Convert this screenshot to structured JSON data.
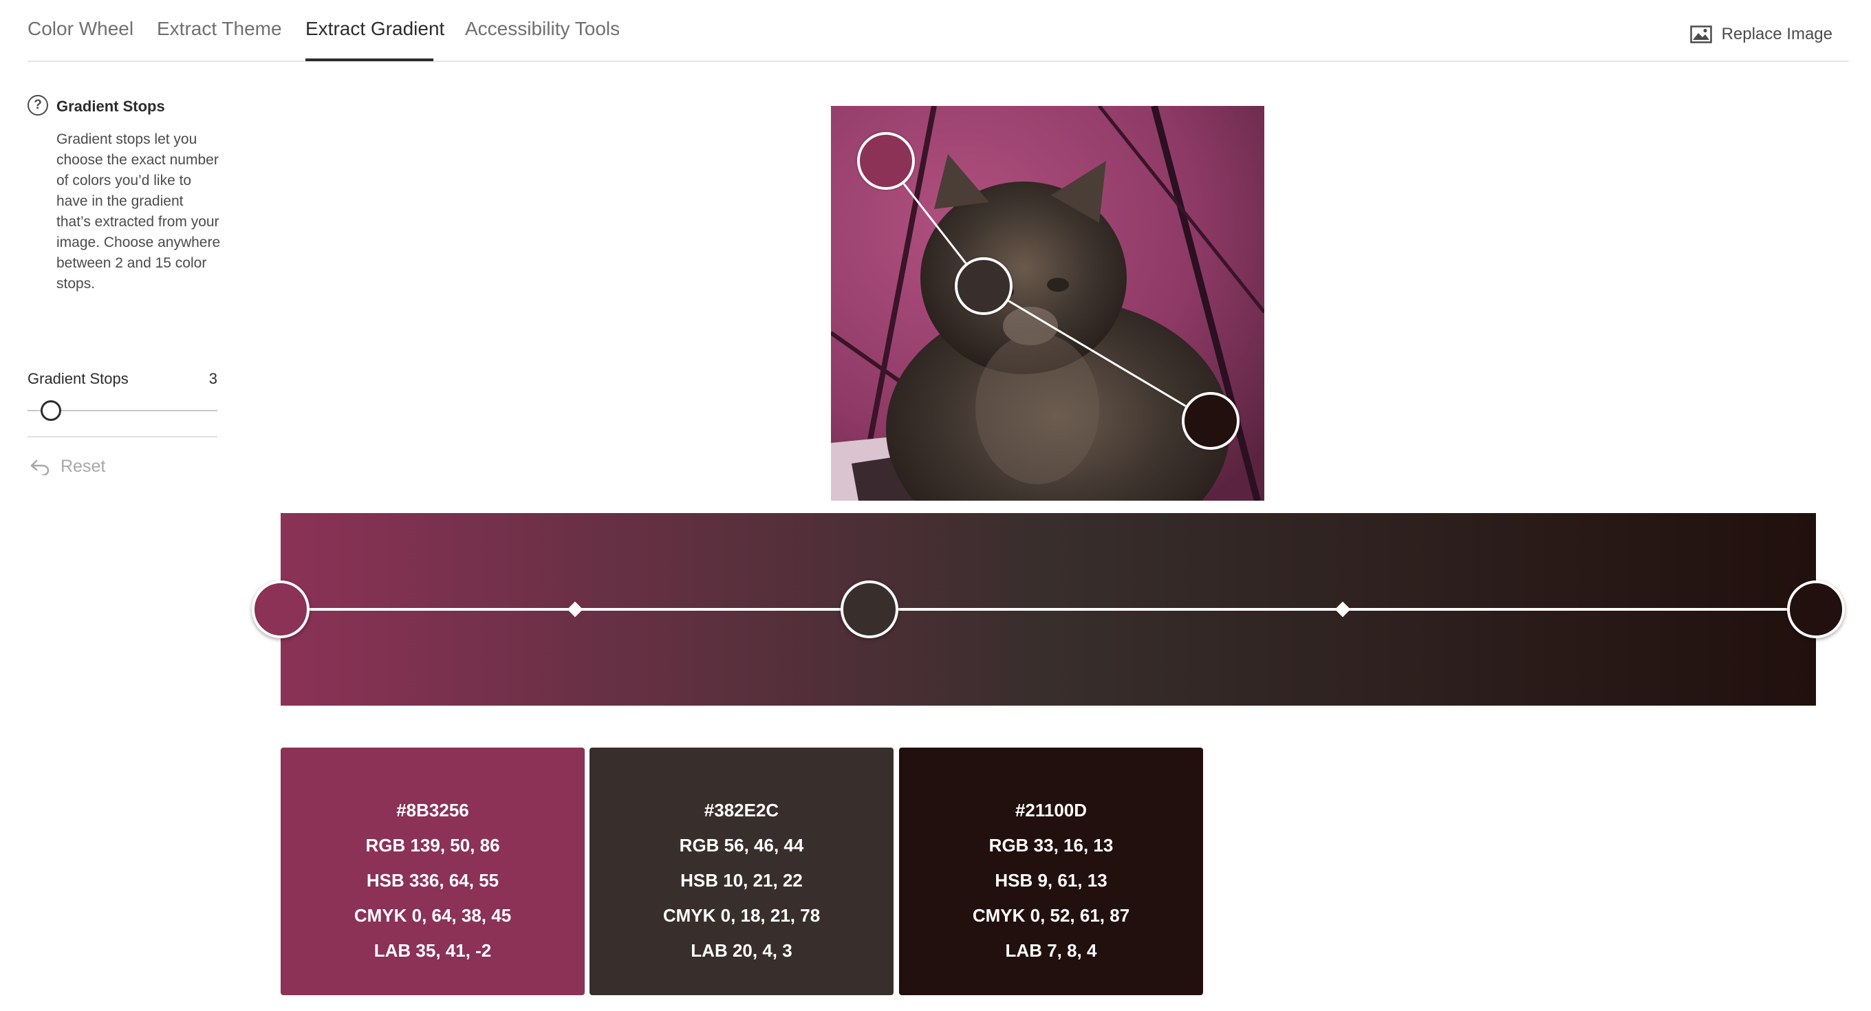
{
  "nav": {
    "tabs": [
      {
        "label": "Color Wheel"
      },
      {
        "label": "Extract Theme"
      },
      {
        "label": "Extract Gradient"
      },
      {
        "label": "Accessibility Tools"
      }
    ],
    "active_tab": "Extract Gradient",
    "replace_label": "Replace Image"
  },
  "sidebar": {
    "help_icon": "?",
    "help_title": "Gradient Stops",
    "help_text": "Gradient stops let you choose the exact number of colors you’d like to have in the gradient that’s extracted from your image. Choose anywhere between 2 and 15 color stops.",
    "stops_label": "Gradient Stops",
    "stops_value": "3",
    "slider_min": 2,
    "slider_max": 15,
    "reset_label": "Reset"
  },
  "colors": {
    "stop1": "#8B3256",
    "stop2": "#382E2C",
    "stop3": "#21100D",
    "accent_text": "#2C2C2C"
  },
  "swatches": [
    {
      "hex": "#8B3256",
      "rgb": "RGB 139, 50, 86",
      "hsb": "HSB 336, 64, 55",
      "cmyk": "CMYK 0, 64, 38, 45",
      "lab": "LAB 35, 41, -2"
    },
    {
      "hex": "#382E2C",
      "rgb": "RGB 56, 46, 44",
      "hsb": "HSB 10, 21, 22",
      "cmyk": "CMYK 0, 18, 21, 78",
      "lab": "LAB 20, 4, 3"
    },
    {
      "hex": "#21100D",
      "rgb": "RGB 33, 16, 13",
      "hsb": "HSB 9, 61, 13",
      "cmyk": "CMYK 0, 52, 61, 87",
      "lab": "LAB 7, 8, 4"
    }
  ]
}
